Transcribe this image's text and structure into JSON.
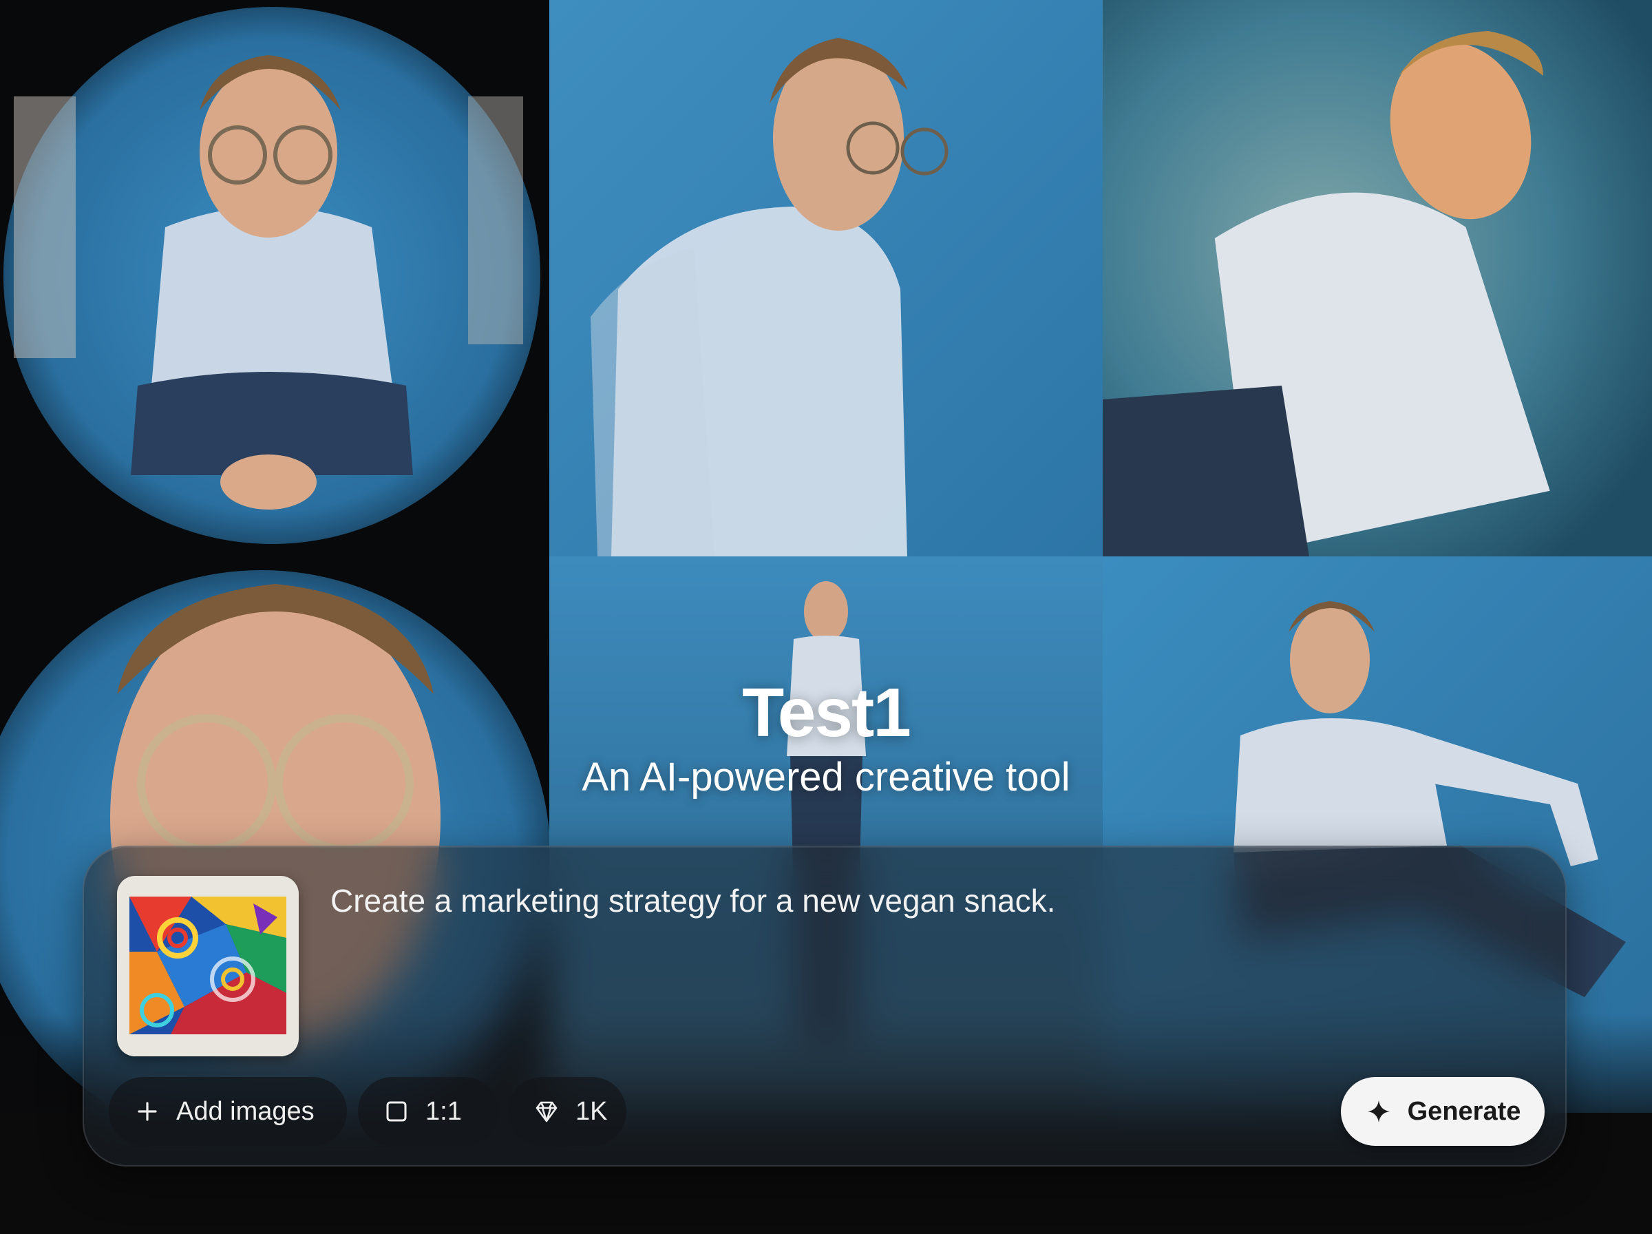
{
  "hero": {
    "title": "Test1",
    "subtitle": "An AI-powered creative tool"
  },
  "gallery": {
    "tiles": [
      {
        "name": "fisheye-crouching-portrait"
      },
      {
        "name": "motion-blur-turning-portrait"
      },
      {
        "name": "tilted-warm-light-portrait"
      },
      {
        "name": "fisheye-face-closeup"
      },
      {
        "name": "standing-full-body-portrait"
      },
      {
        "name": "seated-floor-portrait"
      }
    ],
    "background_color": "#2f7fb0"
  },
  "composer": {
    "prompt": "Create a marketing strategy for a new vegan snack.",
    "thumbnail_icon": "abstract-art-thumbnail",
    "add_images_label": "Add images",
    "aspect_label": "1:1",
    "quality_label": "1K",
    "generate_label": "Generate",
    "icons": {
      "add": "plus-icon",
      "aspect": "square-icon",
      "quality": "diamond-icon",
      "generate": "sparkle-icon"
    }
  }
}
